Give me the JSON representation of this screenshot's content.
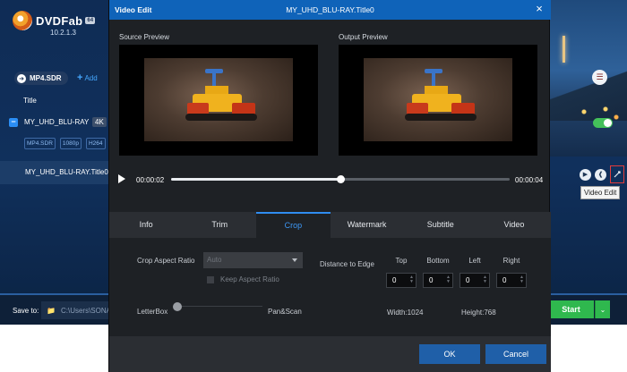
{
  "app": {
    "brand": "DVDFab",
    "brand_badge": "64",
    "version": "10.2.1.3",
    "profile": "MP4.SDR",
    "add_label": "Add",
    "title_column": "Title",
    "source": {
      "name": "MY_UHD_BLU-RAY",
      "resolution_badge": "4K",
      "tags": [
        "MP4.SDR",
        "1080p",
        "H264"
      ]
    },
    "title_row": "MY_UHD_BLU-RAY.Title0",
    "tooltip": "Video Edit",
    "save_to_label": "Save to:",
    "save_path": "C:\\Users\\SONA",
    "start_label": "Start",
    "accent_green": "#2fb84e",
    "accent_blue": "#0f63b9"
  },
  "dialog": {
    "title": "Video Edit",
    "subtitle": "MY_UHD_BLU-RAY.Title0",
    "source_preview_label": "Source Preview",
    "output_preview_label": "Output Preview",
    "player": {
      "time_current": "00:00:02",
      "time_total": "00:00:04",
      "progress": 0.5
    },
    "tabs": [
      {
        "label": "Info",
        "active": false
      },
      {
        "label": "Trim",
        "active": false
      },
      {
        "label": "Crop",
        "active": true
      },
      {
        "label": "Watermark",
        "active": false
      },
      {
        "label": "Subtitle",
        "active": false
      },
      {
        "label": "Video",
        "active": false
      }
    ],
    "crop": {
      "aspect_ratio_label": "Crop Aspect Ratio",
      "aspect_ratio_value": "Auto",
      "keep_aspect_label": "Keep Aspect Ratio",
      "distance_label": "Distance to Edge",
      "edges": [
        {
          "label": "Top",
          "value": "0"
        },
        {
          "label": "Bottom",
          "value": "0"
        },
        {
          "label": "Left",
          "value": "0"
        },
        {
          "label": "Right",
          "value": "0"
        }
      ],
      "letterbox_label": "LetterBox",
      "panscan_label": "Pan&Scan",
      "letterbox_level": 0,
      "width_label": "Width:1024",
      "height_label": "Height:768"
    },
    "ok_label": "OK",
    "cancel_label": "Cancel"
  }
}
